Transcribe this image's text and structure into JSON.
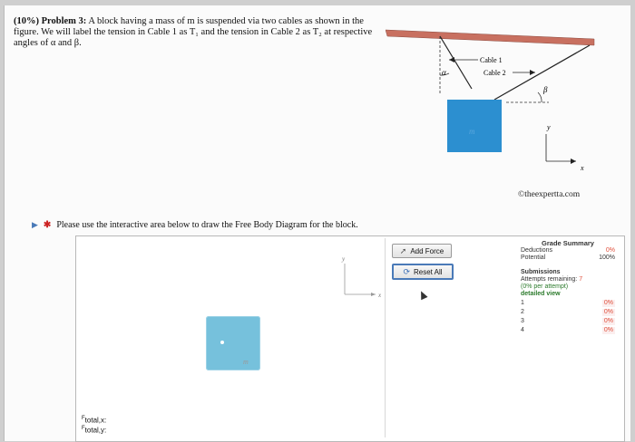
{
  "problem": {
    "heading": "(10%) Problem 3:",
    "text": "A block having a mass of m is suspended via two cables as shown in the figure. We will label the tension in Cable 1 as T₁ and the tension in Cable 2 as T₂ at respective angles of α and β."
  },
  "figure": {
    "cable1_label": "Cable 1",
    "cable2_label": "Cable 2",
    "alpha": "α",
    "beta": "β",
    "mass": "m",
    "axis_y": "y",
    "axis_x": "x",
    "credit": "©theexpertta.com"
  },
  "instruction": "Please use the interactive area below to draw the Free Body Diagram for the block.",
  "fbd": {
    "axis_y": "y",
    "axis_x": "x",
    "block_label": "m",
    "total_x_label": "total,x:",
    "total_y_label": "total,y:",
    "force_prefix": "F"
  },
  "buttons": {
    "add_force": "Add Force",
    "reset_all": "Reset All"
  },
  "grade_summary": {
    "title": "Grade Summary",
    "deductions_label": "Deductions",
    "deductions_value": "0%",
    "potential_label": "Potential",
    "potential_value": "100%",
    "submissions_label": "Submissions",
    "attempts_label": "Attempts remaining:",
    "attempts_value": "7",
    "per_attempt": "(0% per attempt)",
    "detailed_view": "detailed view",
    "attempts": [
      {
        "n": "1",
        "value": "0%"
      },
      {
        "n": "2",
        "value": "0%"
      },
      {
        "n": "3",
        "value": "0%"
      },
      {
        "n": "4",
        "value": "0%"
      }
    ]
  },
  "colors": {
    "ceiling": "#c87060",
    "block": "#2c8fd0",
    "fbd_block": "#76c1dc",
    "accent": "#4a7ab8"
  }
}
